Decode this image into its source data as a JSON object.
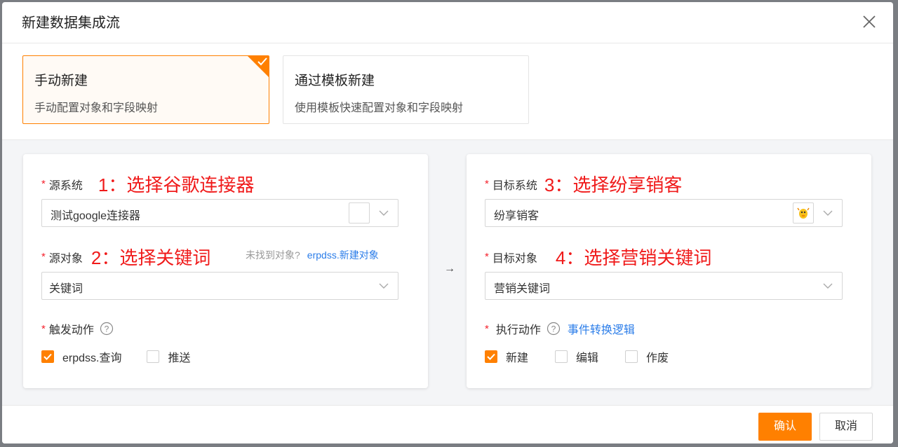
{
  "modal": {
    "title": "新建数据集成流"
  },
  "modes": [
    {
      "title": "手动新建",
      "desc": "手动配置对象和字段映射",
      "selected": true
    },
    {
      "title": "通过模板新建",
      "desc": "使用模板快速配置对象和字段映射",
      "selected": false
    }
  ],
  "source": {
    "system_label": "源系统",
    "system_annotation": "1：选择谷歌连接器",
    "system_value": "测试google连接器",
    "object_label": "源对象",
    "object_annotation": "2：选择关键词",
    "object_hint": "未找到对象?",
    "object_link": "erpdss.新建对象",
    "object_value": "关键词",
    "trigger_label": "触发动作",
    "triggers": [
      {
        "label": "erpdss.查询",
        "checked": true
      },
      {
        "label": "推送",
        "checked": false
      }
    ]
  },
  "target": {
    "system_label": "目标系统",
    "system_annotation": "3：选择纷享销客",
    "system_value": "纷享销客",
    "object_label": "目标对象",
    "object_annotation": "4：选择营销关键词",
    "object_value": "营销关键词",
    "action_label": "执行动作",
    "action_link": "事件转换逻辑",
    "actions": [
      {
        "label": "新建",
        "checked": true
      },
      {
        "label": "编辑",
        "checked": false
      },
      {
        "label": "作废",
        "checked": false
      }
    ]
  },
  "arrow": "→",
  "footer": {
    "confirm": "确认",
    "cancel": "取消"
  },
  "colors": {
    "accent": "#ff8000",
    "annotation": "#f01a1a",
    "link": "#2b7de9"
  }
}
